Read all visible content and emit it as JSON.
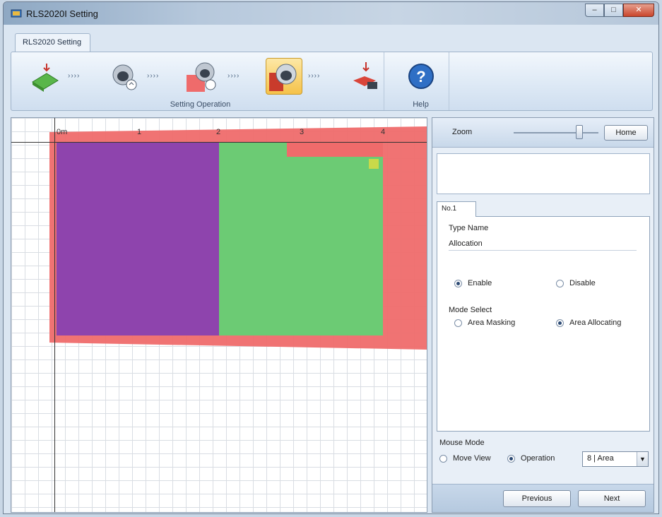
{
  "window": {
    "title": "RLS2020I Setting",
    "controls": {
      "minimize": "–",
      "maximize": "□",
      "close": "✕"
    }
  },
  "ribbon": {
    "tab": "RLS2020 Setting",
    "steps_group_label": "Setting Operation",
    "help_group_label": "Help",
    "arrow_text": "››››",
    "steps": [
      {
        "icon": "green-arrow-step-icon",
        "active": false
      },
      {
        "icon": "camera-setup-icon",
        "active": false
      },
      {
        "icon": "camera-area-icon",
        "active": false
      },
      {
        "icon": "camera-zone-icon",
        "active": true
      },
      {
        "icon": "export-step-icon",
        "active": false
      }
    ]
  },
  "canvas": {
    "tick_labels": [
      "0m",
      "1",
      "2",
      "3",
      "4"
    ],
    "zones": [
      {
        "name": "outer-area",
        "color": "#ef6b6b"
      },
      {
        "name": "purple-zone",
        "color": "#8e44ad"
      },
      {
        "name": "green-zone",
        "color": "#6ccb74"
      }
    ]
  },
  "panel": {
    "zoom_label": "Zoom",
    "home_button": "Home",
    "tab_label": "No.1",
    "type_name_label": "Type Name",
    "type_name_value": "Allocation",
    "enable_label": "Enable",
    "disable_label": "Disable",
    "enable_selected": true,
    "mode_select_label": "Mode Select",
    "area_masking_label": "Area Masking",
    "area_allocating_label": "Area Allocating",
    "area_allocating_selected": true,
    "mouse_mode_label": "Mouse Mode",
    "move_view_label": "Move View",
    "operation_label": "Operation",
    "operation_selected": true,
    "area_select_value": "8 | Area",
    "previous_button": "Previous",
    "next_button": "Next"
  }
}
